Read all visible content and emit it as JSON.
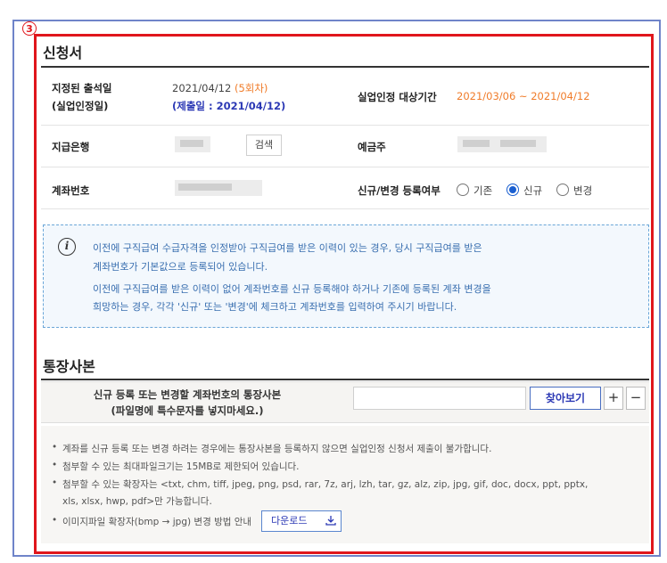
{
  "badge": "3",
  "application": {
    "title": "신청서",
    "designated_date_label_line1": "지정된 출석일",
    "designated_date_label_line2": "(실업인정일)",
    "designated_date_value": "2021/04/12",
    "designated_round": "(5회차)",
    "submit_date": "(제출일 : 2021/04/12)",
    "period_label": "실업인정 대상기간",
    "period_value": "2021/03/06 ~ 2021/04/12",
    "bank_label": "지급은행",
    "bank_search_button": "검색",
    "depositor_label": "예금주",
    "account_label": "계좌번호",
    "registration_label": "신규/변경 등록여부",
    "registration_options": [
      "기존",
      "신규",
      "변경"
    ],
    "registration_selected": "신규"
  },
  "notice": {
    "icon": "info-icon",
    "lines": [
      "이전에 구직급여 수급자격을 인정받아 구직급여를 받은 이력이 있는 경우, 당시 구직급여를 받은",
      "계좌번호가 기본값으로 등록되어 있습니다.",
      "이전에 구직급여를 받은 이력이 없어 계좌번호를 신규 등록해야 하거나 기존에 등록된 계좌 변경을",
      "희망하는 경우, 각각 '신규' 또는 '변경'에 체크하고 계좌번호를 입력하여 주시기 바랍니다."
    ]
  },
  "passbook": {
    "title": "통장사본",
    "file_label_line1": "신규 등록 또는 변경할 계좌번호의 통장사본",
    "file_label_line2": "(파일명에 특수문자를 넣지마세요.)",
    "browse_button": "찾아보기",
    "add_button": "+",
    "remove_button": "−",
    "notes": [
      "계좌를 신규 등록 또는 변경 하려는 경우에는 통장사본을 등록하지 않으면 실업인정 신청서 제출이 불가합니다.",
      "첨부할 수 있는 최대파일크기는 15MB로 제한되어 있습니다.",
      "첨부할 수 있는 확장자는 <txt, chm, tiff, jpeg, png, psd, rar, 7z, arj, lzh, tar, gz, alz, zip, jpg, gif, doc, docx, ppt, pptx,",
      "xls, xlsx, hwp, pdf>만 가능합니다.",
      "이미지파일 확장자(bmp → jpg) 변경 방법 안내"
    ],
    "download_button": "다운로드"
  },
  "colors": {
    "frame_red": "#e0161c",
    "frame_blue": "#6f84c9",
    "accent_orange": "#f07c2a",
    "accent_blue": "#2c39b5",
    "radio_selected": "#1a5fd0"
  }
}
